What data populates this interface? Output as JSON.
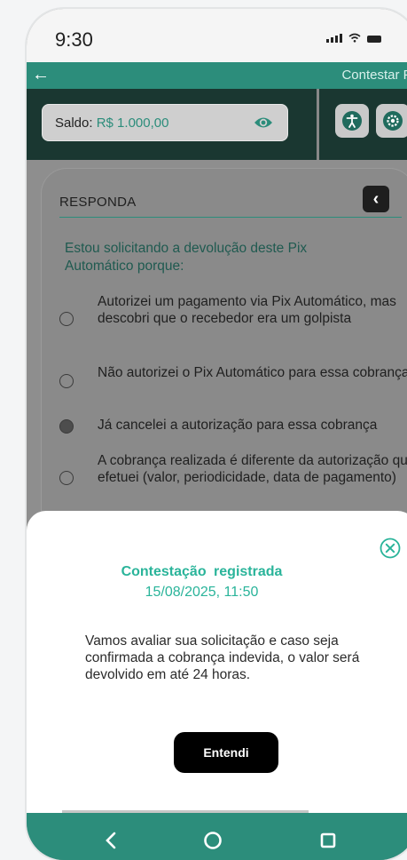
{
  "status_bar": {
    "time": "9:30"
  },
  "app_bar": {
    "title": "Contestar Pi"
  },
  "balance": {
    "label": "Saldo:",
    "value": "R$ 1.000,00"
  },
  "card": {
    "title": "RESPONDA",
    "question": "Estou solicitando a devolução deste Pix Automático porque:",
    "options": [
      {
        "label": "Autorizei um pagamento via Pix Automático, mas descobri que o recebedor era um golpista",
        "selected": false
      },
      {
        "label": "Não autorizei o Pix Automático para essa cobrança",
        "selected": false
      },
      {
        "label": "Já cancelei a autorização para essa cobrança",
        "selected": true
      },
      {
        "label": "A cobrança realizada é diferente da autorização que efetuei (valor, periodicidade, data de pagamento)",
        "selected": false
      }
    ]
  },
  "sheet": {
    "title": "Contestação registrada",
    "datetime": "15/08/2025, 11:50",
    "message": "Vamos avaliar sua solicitação e caso seja confirmada a cobrança indevida, o valor será devolvido em até 24 horas.",
    "button_label": "Entendi"
  },
  "icons": {
    "back": "arrow-left-icon",
    "eye": "eye-icon",
    "accessibility": "accessibility-icon",
    "settings": "gear-icon",
    "card_back": "chevron-left-icon",
    "close": "close-circle-icon",
    "nav_back": "nav-back-icon",
    "nav_home": "nav-home-icon",
    "nav_recent": "nav-recent-icon"
  },
  "colors": {
    "brand": "#2c8d7b",
    "accent_text": "#2ab49a",
    "toolbar": "#1a3731",
    "button": "#000000"
  }
}
